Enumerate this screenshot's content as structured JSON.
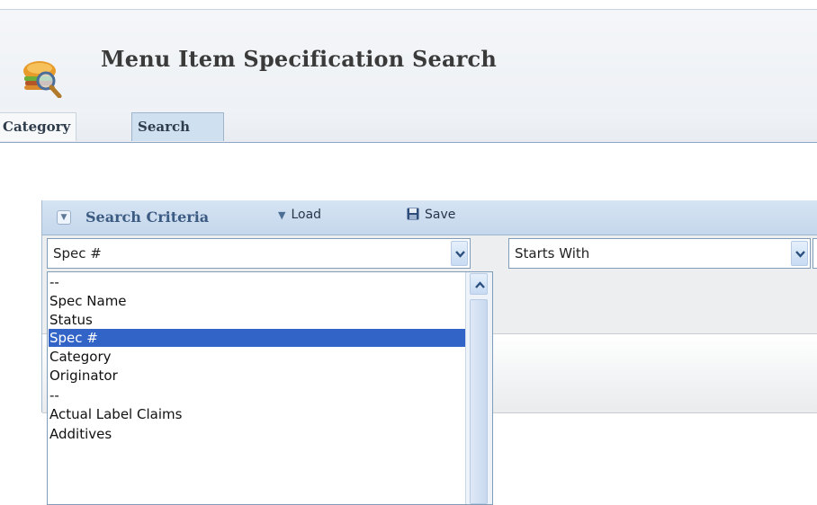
{
  "page": {
    "title": "Menu Item Specification Search"
  },
  "tabs": [
    {
      "label": "Category",
      "active": false
    },
    {
      "label": "Search",
      "active": true
    }
  ],
  "search_panel": {
    "title": "Search Criteria",
    "load_label": "Load",
    "save_label": "Save",
    "field_select_value": "Spec #",
    "operator_select_value": "Starts With",
    "value_input": ""
  },
  "dropdown": {
    "options": [
      "--",
      "Spec Name",
      "Status",
      "Spec #",
      "Category",
      "Originator",
      "--",
      "Actual Label Claims",
      "Additives"
    ],
    "selected": "Spec #"
  },
  "colors": {
    "selection": "#3264c8",
    "panel_header": "#c5d7ec",
    "tab_active": "#cfe0f0",
    "title_text": "#3b5b82"
  },
  "icons": {
    "app": "food-search-icon",
    "collapse": "chevron-down-icon",
    "load": "triangle-down-icon",
    "save": "floppy-disk-icon"
  }
}
